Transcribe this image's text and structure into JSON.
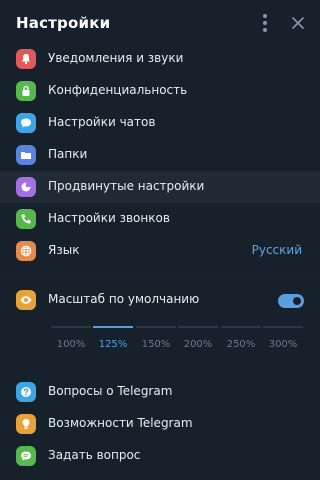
{
  "header": {
    "title": "Настройки"
  },
  "group1": [
    {
      "label": "Уведомления и звуки",
      "icon": "bell-icon",
      "color": "#e05a5a"
    },
    {
      "label": "Конфиденциальность",
      "icon": "lock-icon",
      "color": "#58b84d"
    },
    {
      "label": "Настройки чатов",
      "icon": "chat-bubble-icon",
      "color": "#3ea5e5"
    },
    {
      "label": "Папки",
      "icon": "folder-icon",
      "color": "#5a82e0"
    },
    {
      "label": "Продвинутые настройки",
      "icon": "pie-chart-icon",
      "color": "#a46fe0",
      "active": true
    },
    {
      "label": "Настройки звонков",
      "icon": "phone-icon",
      "color": "#58b84d"
    },
    {
      "label": "Язык",
      "icon": "globe-icon",
      "color": "#e88a4a",
      "value": "Русский"
    }
  ],
  "scale": {
    "label": "Масштаб по умолчанию",
    "icon": "eye-icon",
    "color": "#e8a23a",
    "enabled": true,
    "options": [
      "100%",
      "125%",
      "150%",
      "200%",
      "250%",
      "300%"
    ],
    "selected": "125%"
  },
  "group2": [
    {
      "label": "Вопросы о Telegram",
      "icon": "question-icon",
      "color": "#3ea5e5"
    },
    {
      "label": "Возможности Telegram",
      "icon": "lightbulb-icon",
      "color": "#e8a23a"
    },
    {
      "label": "Задать вопрос",
      "icon": "chat-dots-icon",
      "color": "#58b84d"
    }
  ]
}
